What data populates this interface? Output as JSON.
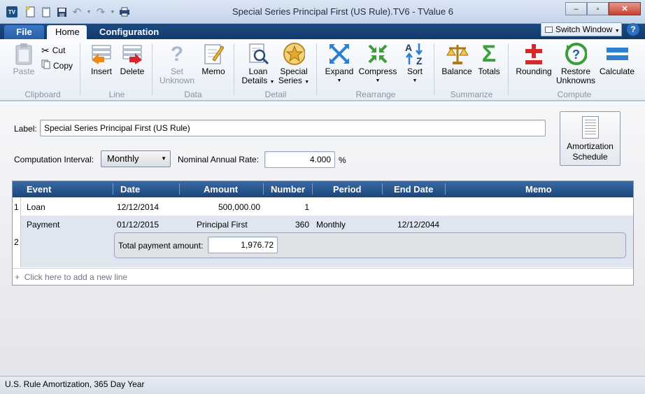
{
  "window": {
    "title": "Special Series Principal First (US Rule).TV6 - TValue 6",
    "app_icon_text": "TV",
    "controls": {
      "minimize": "–",
      "maximize": "▫",
      "close": "✕"
    }
  },
  "quick_access": [
    "new-icon",
    "open-icon",
    "save-icon",
    "undo-icon",
    "redo-icon",
    "print-icon"
  ],
  "tabs": {
    "file": "File",
    "home": "Home",
    "configuration": "Configuration"
  },
  "switch_window": "Switch Window",
  "help": "?",
  "ribbon": {
    "clipboard": {
      "paste": "Paste",
      "cut": "Cut",
      "copy": "Copy",
      "group": "Clipboard"
    },
    "line": {
      "insert": "Insert",
      "delete": "Delete",
      "group": "Line"
    },
    "data": {
      "set_unknown_1": "Set",
      "set_unknown_2": "Unknown",
      "memo": "Memo",
      "group": "Data"
    },
    "detail": {
      "loan_1": "Loan",
      "loan_2": "Details",
      "special_1": "Special",
      "special_2": "Series",
      "group": "Detail"
    },
    "rearrange": {
      "expand": "Expand",
      "compress": "Compress",
      "sort": "Sort",
      "group": "Rearrange"
    },
    "summarize": {
      "balance": "Balance",
      "totals": "Totals",
      "group": "Summarize"
    },
    "compute": {
      "rounding": "Rounding",
      "restore_1": "Restore",
      "restore_2": "Unknowns",
      "calculate": "Calculate",
      "group": "Compute"
    }
  },
  "form": {
    "label_caption": "Label:",
    "label_value": "Special Series Principal First (US Rule)",
    "interval_caption": "Computation Interval:",
    "interval_value": "Monthly",
    "rate_caption": "Nominal Annual Rate:",
    "rate_value": "4.000",
    "rate_unit": "%",
    "amort_1": "Amortization",
    "amort_2": "Schedule"
  },
  "grid": {
    "headers": {
      "event": "Event",
      "date": "Date",
      "amount": "Amount",
      "number": "Number",
      "period": "Period",
      "end_date": "End Date",
      "memo": "Memo"
    },
    "rows": [
      {
        "index": "1",
        "event": "Loan",
        "date": "12/12/2014",
        "amount": "500,000.00",
        "number": "1",
        "period": "",
        "end_date": ""
      },
      {
        "index": "2",
        "event": "Payment",
        "date": "01/12/2015",
        "amount": "Principal First",
        "number": "360",
        "period": "Monthly",
        "end_date": "12/12/2044"
      }
    ],
    "payment_total_label": "Total payment amount:",
    "payment_total_value": "1,976.72",
    "add_line": "Click here to add a new line",
    "add_line_prefix": "+"
  },
  "status": "U.S. Rule Amortization, 365 Day Year"
}
